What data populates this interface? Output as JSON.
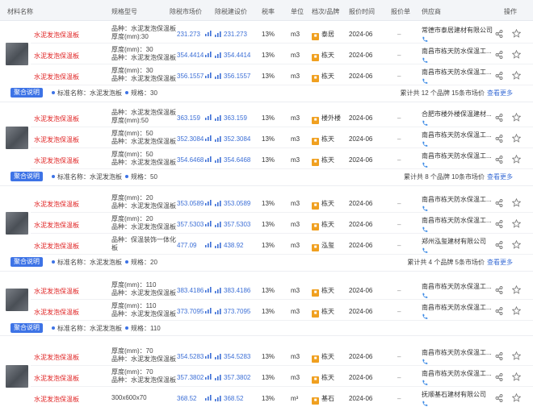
{
  "columns": {
    "material": "材料名称",
    "spec": "规格型号",
    "market_price": "除税市场价",
    "suggest_price": "除税建设价",
    "tax": "税率",
    "unit": "单位",
    "brand": "档次/品牌",
    "date": "报价时间",
    "quote": "报价单",
    "supplier": "供应商",
    "action": "操作"
  },
  "colors": {
    "accent": "#3d73e6",
    "price": "#3c6fd6",
    "name": "#e02424",
    "brand_icon": "#f0a020"
  },
  "badge_label": "聚合说明",
  "more_label": "查看更多",
  "groups": [
    {
      "rows": [
        {
          "name": "水泥发泡保温板",
          "spec": [
            "品种：水泥发泡保温板",
            "厚度(mm):30"
          ],
          "price1": "231.273",
          "price2": "231.273",
          "tax": "13%",
          "unit": "m3",
          "brand": "泰居",
          "date": "2024-06",
          "quote": "–",
          "supplier": "常德市泰居建材有限公司"
        },
        {
          "name": "水泥发泡保温板",
          "spec": [
            "厚度(mm)：30",
            "品种：水泥发泡保温板"
          ],
          "price1": "354.4414",
          "price2": "354.4414",
          "tax": "13%",
          "unit": "m3",
          "brand": "栋天",
          "date": "2024-06",
          "quote": "–",
          "supplier": "南昌市栋天防水保温工..."
        },
        {
          "name": "水泥发泡保温板",
          "spec": [
            "厚度(mm)：30",
            "品种：水泥发泡保温板"
          ],
          "price1": "356.1557",
          "price2": "356.1557",
          "tax": "13%",
          "unit": "m3",
          "brand": "栋天",
          "date": "2024-06",
          "quote": "–",
          "supplier": "南昌市栋天防水保温工..."
        }
      ],
      "tags": [
        "标准名称：水泥发泡板",
        "规格：30"
      ],
      "summary": "累计共 12 个品牌 15条市场价"
    },
    {
      "rows": [
        {
          "name": "水泥发泡保温板",
          "spec": [
            "品种：水泥发泡保温板",
            "厚度(mm):50"
          ],
          "price1": "363.159",
          "price2": "363.159",
          "tax": "13%",
          "unit": "m3",
          "brand": "楼外楼",
          "date": "2024-06",
          "quote": "–",
          "supplier": "合肥市楼外楼保温建材..."
        },
        {
          "name": "水泥发泡保温板",
          "spec": [
            "厚度(mm)：50",
            "品种：水泥发泡保温板"
          ],
          "price1": "352.3084",
          "price2": "352.3084",
          "tax": "13%",
          "unit": "m3",
          "brand": "栋天",
          "date": "2024-06",
          "quote": "–",
          "supplier": "南昌市栋天防水保温工..."
        },
        {
          "name": "水泥发泡保温板",
          "spec": [
            "厚度(mm)：50",
            "品种：水泥发泡保温板"
          ],
          "price1": "354.6468",
          "price2": "354.6468",
          "tax": "13%",
          "unit": "m3",
          "brand": "栋天",
          "date": "2024-06",
          "quote": "–",
          "supplier": "南昌市栋天防水保温工..."
        }
      ],
      "tags": [
        "标准名称：水泥发泡板",
        "规格：50"
      ],
      "summary": "累计共 8 个品牌 10条市场价"
    },
    {
      "rows": [
        {
          "name": "水泥发泡保温板",
          "spec": [
            "厚度(mm)：20",
            "品种：水泥发泡保温板"
          ],
          "price1": "353.0589",
          "price2": "353.0589",
          "tax": "13%",
          "unit": "m3",
          "brand": "栋天",
          "date": "2024-06",
          "quote": "–",
          "supplier": "南昌市栋天防水保温工..."
        },
        {
          "name": "水泥发泡保温板",
          "spec": [
            "厚度(mm)：20",
            "品种：水泥发泡保温板"
          ],
          "price1": "357.5303",
          "price2": "357.5303",
          "tax": "13%",
          "unit": "m3",
          "brand": "栋天",
          "date": "2024-06",
          "quote": "–",
          "supplier": "南昌市栋天防水保温工..."
        },
        {
          "name": "水泥发泡保温板",
          "spec": [
            "品种：保温装饰一体化",
            "板"
          ],
          "price1": "477.09",
          "price2": "438.92",
          "tax": "13%",
          "unit": "m3",
          "brand": "泓玺",
          "date": "2024-06",
          "quote": "–",
          "supplier": "郑州泓玺建材有限公司"
        }
      ],
      "tags": [
        "标准名称：水泥发泡板",
        "规格：20"
      ],
      "summary": "累计共 4 个品牌 5条市场价"
    },
    {
      "rows": [
        {
          "name": "水泥发泡保温板",
          "spec": [
            "厚度(mm)：110",
            "品种：水泥发泡保温板"
          ],
          "price1": "383.4186",
          "price2": "383.4186",
          "tax": "13%",
          "unit": "m3",
          "brand": "栋天",
          "date": "2024-06",
          "quote": "–",
          "supplier": "南昌市栋天防水保温工..."
        },
        {
          "name": "水泥发泡保温板",
          "spec": [
            "厚度(mm)：110",
            "品种：水泥发泡保温板"
          ],
          "price1": "373.7095",
          "price2": "373.7095",
          "tax": "13%",
          "unit": "m3",
          "brand": "栋天",
          "date": "2024-06",
          "quote": "–",
          "supplier": "南昌市栋天防水保温工..."
        }
      ],
      "tags": [
        "标准名称：水泥发泡板",
        "规格：110"
      ],
      "summary": ""
    },
    {
      "rows": [
        {
          "name": "水泥发泡保温板",
          "spec": [
            "厚度(mm)：70",
            "品种：水泥发泡保温板"
          ],
          "price1": "354.5283",
          "price2": "354.5283",
          "tax": "13%",
          "unit": "m3",
          "brand": "栋天",
          "date": "2024-06",
          "quote": "–",
          "supplier": "南昌市栋天防水保温工..."
        },
        {
          "name": "水泥发泡保温板",
          "spec": [
            "厚度(mm)：70",
            "品种：水泥发泡保温板"
          ],
          "price1": "357.3802",
          "price2": "357.3802",
          "tax": "13%",
          "unit": "m3",
          "brand": "栋天",
          "date": "2024-06",
          "quote": "–",
          "supplier": "南昌市栋天防水保温工..."
        },
        {
          "name": "水泥发泡保温板",
          "spec": [
            "300x600x70"
          ],
          "price1": "368.52",
          "price2": "368.52",
          "tax": "13%",
          "unit": "m³",
          "brand": "基石",
          "date": "2024-06",
          "quote": "–",
          "supplier": "抚顺基石建材有限公司"
        }
      ],
      "tags": [],
      "summary": ""
    }
  ]
}
